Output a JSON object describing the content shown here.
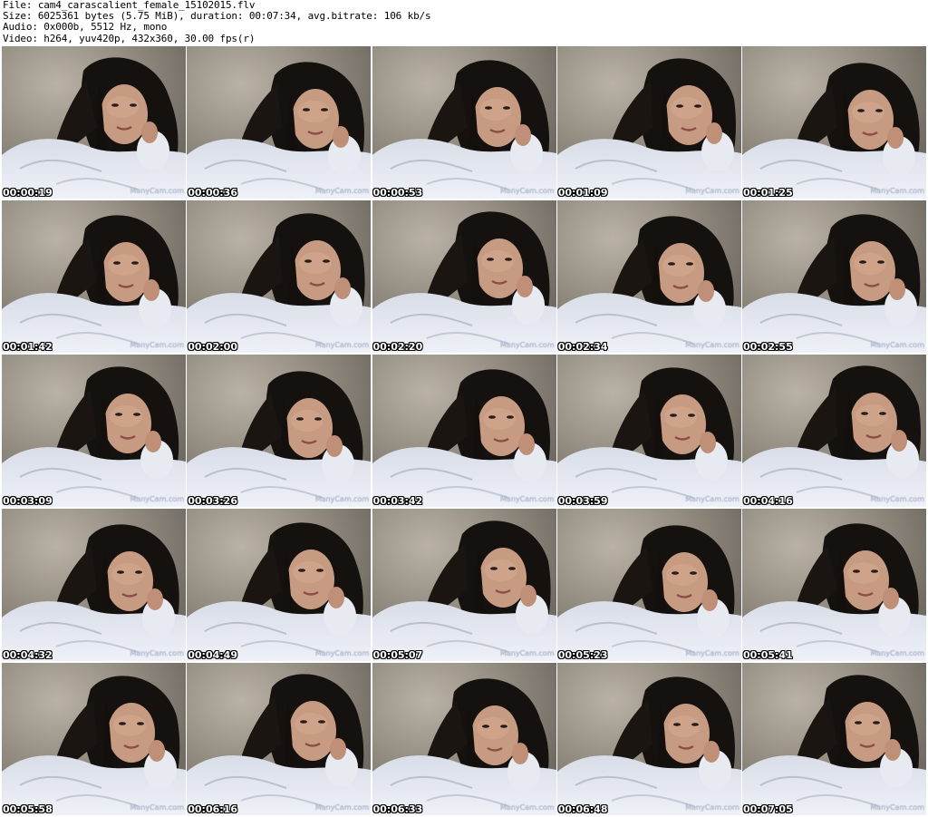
{
  "header": {
    "file_line": "File: cam4_carascalient_female_15102015.flv",
    "size_line": "Size: 6025361 bytes (5.75 MiB), duration: 00:07:34, avg.bitrate: 106 kb/s",
    "audio_line": "Audio: 0x000b, 5512 Hz, mono",
    "video_line": "Video: h264, yuv420p, 432x360, 30.00 fps(r)"
  },
  "thumbnails": [
    {
      "timestamp": "00:00:19"
    },
    {
      "timestamp": "00:00:36"
    },
    {
      "timestamp": "00:00:53"
    },
    {
      "timestamp": "00:01:09"
    },
    {
      "timestamp": "00:01:25"
    },
    {
      "timestamp": "00:01:42"
    },
    {
      "timestamp": "00:02:00"
    },
    {
      "timestamp": "00:02:20"
    },
    {
      "timestamp": "00:02:34"
    },
    {
      "timestamp": "00:02:55"
    },
    {
      "timestamp": "00:03:09"
    },
    {
      "timestamp": "00:03:26"
    },
    {
      "timestamp": "00:03:42"
    },
    {
      "timestamp": "00:03:59"
    },
    {
      "timestamp": "00:04:16"
    },
    {
      "timestamp": "00:04:32"
    },
    {
      "timestamp": "00:04:49"
    },
    {
      "timestamp": "00:05:07"
    },
    {
      "timestamp": "00:05:23"
    },
    {
      "timestamp": "00:05:41"
    },
    {
      "timestamp": "00:05:58"
    },
    {
      "timestamp": "00:06:16"
    },
    {
      "timestamp": "00:06:33"
    },
    {
      "timestamp": "00:06:48"
    },
    {
      "timestamp": "00:07:05"
    }
  ],
  "watermark_text": "ManyCam.com",
  "colors": {
    "timestamp_text": "#ffffff",
    "timestamp_outline": "#000000",
    "background": "#ffffff"
  }
}
